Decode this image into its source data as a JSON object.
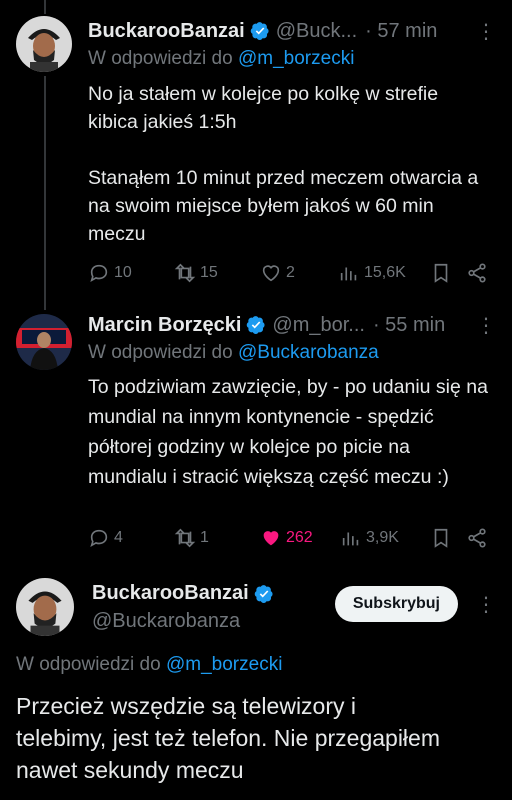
{
  "tweets": [
    {
      "name": "BuckarooBanzai",
      "handle": "@Buck...",
      "time": "· 57 min",
      "reply_prefix": "W odpowiedzi do",
      "reply_mention": "@m_borzecki",
      "text": "No ja stałem w kolejce po kolkę w strefie kibica jakieś 1:5h\n\nStanąłem 10 minut przed meczem otwarcia a na swoim miejsce byłem jakoś w 60 min meczu",
      "replies": "10",
      "reposts": "15",
      "likes": "2",
      "views": "15,6K"
    },
    {
      "name": "Marcin Borzęcki",
      "handle": "@m_bor...",
      "time": "· 55 min",
      "reply_prefix": "W odpowiedzi do",
      "reply_mention": "@Buckarobanza",
      "text": "To podziwiam zawzięcie, by - po udaniu się na mundial na innym kontynencie - spędzić półtorej godziny w kolejce po picie na mundialu i stracić większą część meczu :)",
      "replies": "4",
      "reposts": "1",
      "likes": "262",
      "views": "3,9K"
    }
  ],
  "main": {
    "name": "BuckarooBanzai",
    "handle": "@Buckarobanza",
    "subscribe_label": "Subskrybuj",
    "reply_prefix": "W odpowiedzi do",
    "reply_mention": "@m_borzecki",
    "text": "Przecież wszędzie są telewizory i telebimy, jest też telefon. Nie przegapiłem nawet sekundy meczu"
  },
  "more_glyph": "⋮",
  "colors": {
    "accent": "#1d9bf0",
    "like": "#f91880",
    "muted": "#71767b",
    "background": "#000000"
  }
}
